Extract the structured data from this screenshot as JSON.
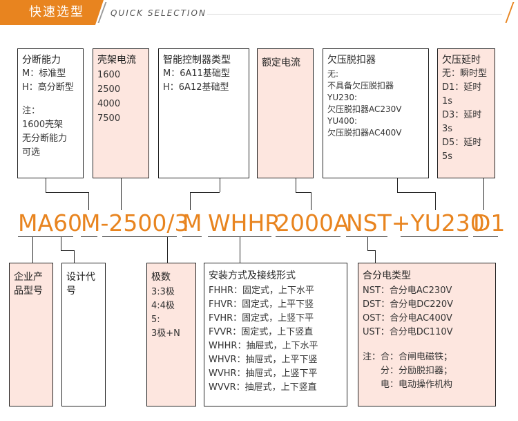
{
  "header": {
    "title": "快速选型",
    "subtitle": "QUICK SELECTION"
  },
  "top_boxes": {
    "breaking": {
      "title": "分断能力",
      "lines": [
        "M：标准型",
        "H：高分断型"
      ],
      "note": [
        "注：",
        "1600壳架",
        "无分断能力",
        "可选"
      ]
    },
    "frame": {
      "title": "壳架电流",
      "lines": [
        "1600",
        "2500",
        "4000",
        "7500"
      ]
    },
    "controller": {
      "title": "智能控制器类型",
      "lines": [
        "M：6A11基础型",
        "H：6A12基础型"
      ]
    },
    "rated": {
      "title": "额定电流"
    },
    "undervoltage": {
      "title": "欠压脱扣器",
      "lines": [
        "无:",
        "不具备欠压脱扣器",
        "YU230:",
        "欠压脱扣器AC230V",
        "YU400:",
        "欠压脱扣器AC400V"
      ]
    },
    "delay": {
      "title": "欠压延时",
      "lines": [
        "无：瞬时型",
        "D1：延时1s",
        "D3：延时3s",
        "D5：延时5s"
      ]
    }
  },
  "model_code": {
    "parts": [
      "MA60",
      "M-2500/3",
      "M",
      "WHHR",
      "2000A",
      "NST+YU230",
      "D1"
    ]
  },
  "bottom_boxes": {
    "enterprise": {
      "title": "企业产品型号"
    },
    "design": {
      "title": "设计代号"
    },
    "poles": {
      "title": "极数",
      "lines": [
        "3:3极",
        "4:4极",
        "5:",
        "3极+N"
      ]
    },
    "install": {
      "title": "安装方式及接线形式",
      "lines": [
        "FHHR：固定式，上下水平",
        "FHVR：固定式，上平下竖",
        "FVHR：固定式，上竖下平",
        "FVVR：固定式，上下竖直",
        "WHHR：抽屉式，上下水平",
        "WHVR：抽屉式，上平下竖",
        "WVHR：抽屉式，上竖下平",
        "WVVR：抽屉式，上下竖直"
      ]
    },
    "shunt": {
      "title": "合分电类型",
      "lines": [
        "NST：合分电AC230V",
        "DST：合分电DC220V",
        "OST：合分电AC400V",
        "UST：合分电DC110V"
      ],
      "note": [
        "注：合：合闸电磁铁；",
        "分：分励脱扣器；",
        "电：电动操作机构"
      ]
    }
  },
  "colors": {
    "accent": "#e8841f",
    "pink": "#fde6df",
    "line": "#222222"
  }
}
